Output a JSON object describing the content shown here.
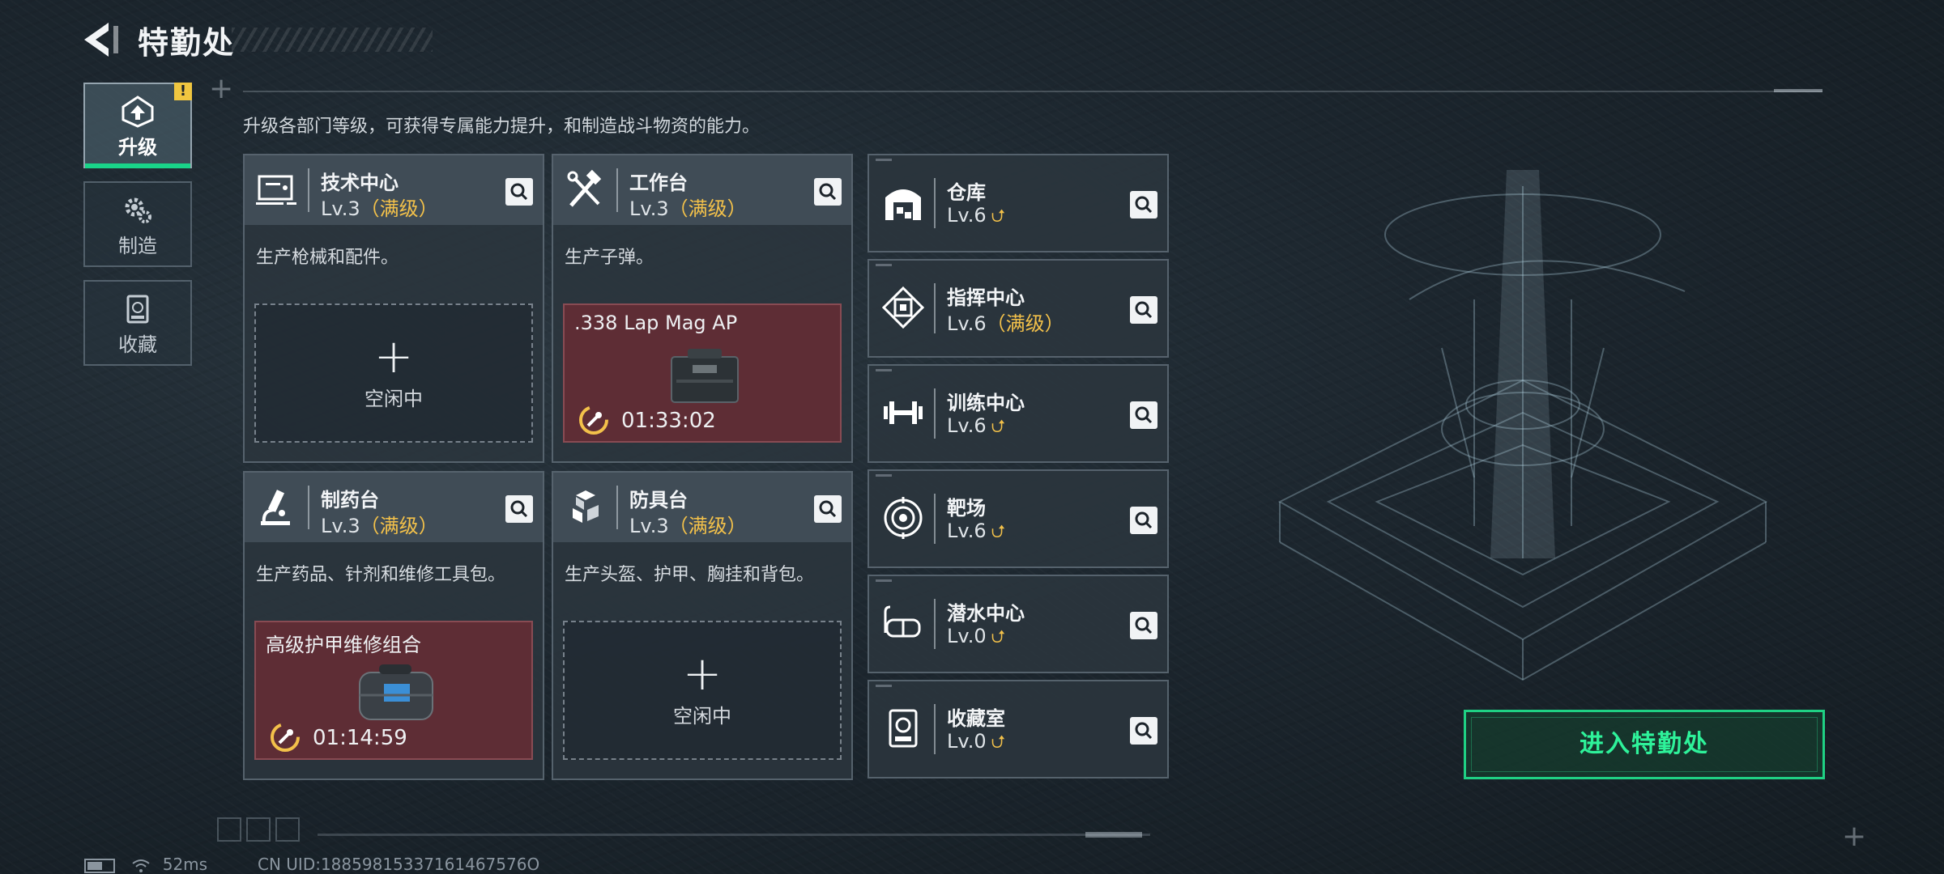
{
  "header": {
    "title": "特勤处"
  },
  "tabs": [
    {
      "label": "升级",
      "icon": "upgrade-icon",
      "active": true,
      "badge": "!"
    },
    {
      "label": "制造",
      "icon": "gears-icon",
      "active": false
    },
    {
      "label": "收藏",
      "icon": "collection-icon",
      "active": false
    }
  ],
  "description": "升级各部门等级，可获得专属能力提升，和制造战斗物资的能力。",
  "stations": [
    {
      "name": "技术中心",
      "level": "Lv.3",
      "max": "（满级）",
      "desc": "生产枪械和配件。",
      "slot": {
        "state": "idle",
        "label": "空闲中"
      },
      "icon": "tech-center-icon"
    },
    {
      "name": "工作台",
      "level": "Lv.3",
      "max": "（满级）",
      "desc": "生产子弹。",
      "slot": {
        "state": "busy",
        "item": ".338 Lap Mag AP",
        "timer": "01:33:02"
      },
      "icon": "workbench-tools-icon"
    },
    {
      "name": "制药台",
      "level": "Lv.3",
      "max": "（满级）",
      "desc": "生产药品、针剂和维修工具包。",
      "slot": {
        "state": "busy",
        "item": "高级护甲维修组合",
        "timer": "01:14:59"
      },
      "icon": "microscope-icon"
    },
    {
      "name": "防具台",
      "level": "Lv.3",
      "max": "（满级）",
      "desc": "生产头盔、护甲、胸挂和背包。",
      "slot": {
        "state": "idle",
        "label": "空闲中"
      },
      "icon": "armor-blocks-icon"
    }
  ],
  "facilities": [
    {
      "name": "仓库",
      "level": "Lv.6",
      "max": "",
      "upgradable": true,
      "icon": "warehouse-icon"
    },
    {
      "name": "指挥中心",
      "level": "Lv.6",
      "max": "（满级）",
      "upgradable": false,
      "icon": "command-center-icon"
    },
    {
      "name": "训练中心",
      "level": "Lv.6",
      "max": "",
      "upgradable": true,
      "icon": "dumbbell-icon"
    },
    {
      "name": "靶场",
      "level": "Lv.6",
      "max": "",
      "upgradable": true,
      "icon": "target-icon"
    },
    {
      "name": "潜水中心",
      "level": "Lv.0",
      "max": "",
      "upgradable": true,
      "icon": "dive-mask-icon"
    },
    {
      "name": "收藏室",
      "level": "Lv.0",
      "max": "",
      "upgradable": true,
      "icon": "collection-room-icon"
    }
  ],
  "enter_button": "进入特勤处",
  "status": {
    "ping": "52ms",
    "uid": "CN UID:18859815337161467576O"
  },
  "colors": {
    "accent": "#1fd184",
    "max_level": "#f3c14a",
    "busy_slot": "#5e2d35"
  }
}
